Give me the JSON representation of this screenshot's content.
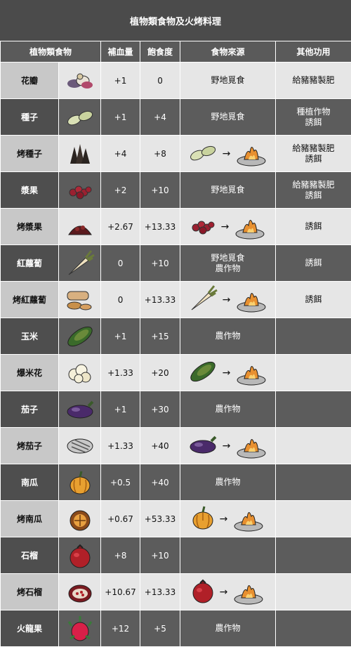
{
  "title": "植物類食物及火烤料理",
  "headers": [
    "植物類食物",
    "補血量",
    "飽食度",
    "食物來源",
    "其他功用"
  ],
  "rows": [
    {
      "name": "花瓣",
      "icon": "petals-icon",
      "hp": "+1",
      "hunger": "0",
      "source": "野地覓食",
      "source_type": "text",
      "other": "給豬豬製肥"
    },
    {
      "name": "種子",
      "icon": "seeds-icon",
      "hp": "+1",
      "hunger": "+4",
      "source": "野地覓食",
      "source_type": "text",
      "other": "種植作物\n誘餌"
    },
    {
      "name": "烤種子",
      "icon": "roasted-seeds-icon",
      "hp": "+4",
      "hunger": "+8",
      "source_icon": "seeds-icon",
      "source_type": "cook",
      "arrow": "→",
      "other": "給豬豬製肥\n誘餌"
    },
    {
      "name": "漿果",
      "icon": "berries-icon",
      "hp": "+2",
      "hunger": "+10",
      "source": "野地覓食",
      "source_type": "text",
      "other": "給豬豬製肥\n誘餌"
    },
    {
      "name": "烤漿果",
      "icon": "roasted-berries-icon",
      "hp": "+2.67",
      "hunger": "+13.33",
      "source_icon": "berries-icon",
      "source_type": "cook",
      "arrow": "→",
      "other": "誘餌"
    },
    {
      "name": "紅蘿蔔",
      "icon": "carrot-icon",
      "hp": "0",
      "hunger": "+10",
      "source": "野地覓食\n農作物",
      "source_type": "text",
      "other": "誘餌"
    },
    {
      "name": "烤紅蘿蔔",
      "icon": "roasted-carrot-icon",
      "hp": "0",
      "hunger": "+13.33",
      "source_icon": "carrot-icon",
      "source_type": "cook",
      "arrow": "→",
      "other": "誘餌"
    },
    {
      "name": "玉米",
      "icon": "corn-icon",
      "hp": "+1",
      "hunger": "+15",
      "source": "農作物",
      "source_type": "text",
      "other": ""
    },
    {
      "name": "爆米花",
      "icon": "popcorn-icon",
      "hp": "+1.33",
      "hunger": "+20",
      "source_icon": "corn-icon",
      "source_type": "cook",
      "arrow": "→",
      "other": ""
    },
    {
      "name": "茄子",
      "icon": "eggplant-icon",
      "hp": "+1",
      "hunger": "+30",
      "source": "農作物",
      "source_type": "text",
      "other": ""
    },
    {
      "name": "烤茄子",
      "icon": "roasted-eggplant-icon",
      "hp": "+1.33",
      "hunger": "+40",
      "source_icon": "eggplant-icon",
      "source_type": "cook",
      "arrow": "→",
      "other": ""
    },
    {
      "name": "南瓜",
      "icon": "pumpkin-icon",
      "hp": "+0.5",
      "hunger": "+40",
      "source": "農作物",
      "source_type": "text",
      "other": ""
    },
    {
      "name": "烤南瓜",
      "icon": "roasted-pumpkin-icon",
      "hp": "+0.67",
      "hunger": "+53.33",
      "source_icon": "pumpkin-icon",
      "source_type": "cook",
      "arrow": "→",
      "other": ""
    },
    {
      "name": "石榴",
      "icon": "pomegranate-icon",
      "hp": "+8",
      "hunger": "+10",
      "source": "",
      "source_type": "text",
      "other": ""
    },
    {
      "name": "烤石榴",
      "icon": "roasted-pomegranate-icon",
      "hp": "+10.67",
      "hunger": "+13.33",
      "source_icon": "pomegranate-icon",
      "source_type": "cook",
      "arrow": "→",
      "other": ""
    },
    {
      "name": "火龍果",
      "icon": "dragonfruit-icon",
      "hp": "+12",
      "hunger": "+5",
      "source": "農作物",
      "source_type": "text",
      "other": ""
    }
  ],
  "colors": {
    "header_bg": "#5a5a5a",
    "title_bg": "#4b4b4b",
    "row_light": "#e6e6e6",
    "row_dark": "#5c5c5c"
  }
}
